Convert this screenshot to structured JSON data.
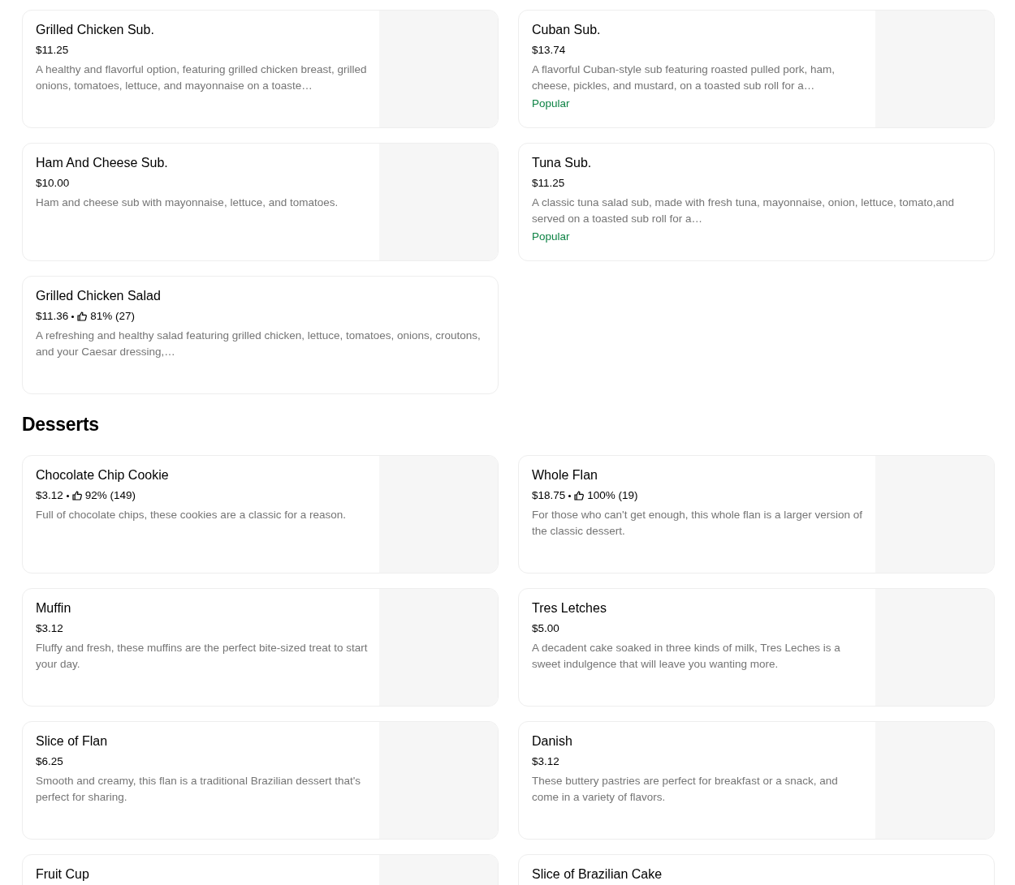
{
  "sections": [
    {
      "items": [
        {
          "name": "Grilled Chicken Sub.",
          "price": "$11.25",
          "description": "A healthy and flavorful option, featuring grilled chicken breast, grilled onions, tomatoes, lettuce, and mayonnaise on a toaste…",
          "has_image": true
        },
        {
          "name": "Cuban Sub.",
          "price": "$13.74",
          "description": "A flavorful Cuban-style sub featuring roasted pulled pork, ham, cheese, pickles, and mustard, on a toasted sub roll for a…",
          "badge": "Popular",
          "has_image": true
        },
        {
          "name": "Ham And Cheese Sub.",
          "price": "$10.00",
          "description": "Ham and cheese sub with mayonnaise, lettuce, and tomatoes.",
          "has_image": true
        },
        {
          "name": "Tuna Sub.",
          "price": "$11.25",
          "description": "A classic tuna salad sub, made with fresh tuna, mayonnaise, onion, lettuce, tomato,and served on a toasted sub roll for a…",
          "badge": "Popular",
          "has_image": false
        },
        {
          "name": "Grilled Chicken Salad",
          "price": "$11.36",
          "rating": "81% (27)",
          "description": "A refreshing and healthy salad featuring grilled chicken, lettuce, tomatoes, onions, croutons, and your Caesar dressing,…",
          "has_image": false
        }
      ]
    },
    {
      "title": "Desserts",
      "items": [
        {
          "name": "Chocolate Chip Cookie",
          "price": "$3.12",
          "rating": "92% (149)",
          "description": "Full of chocolate chips, these cookies are a classic for a reason.",
          "has_image": true
        },
        {
          "name": "Whole Flan",
          "price": "$18.75",
          "rating": "100% (19)",
          "description": "For those who can't get enough, this whole flan is a larger version of the classic dessert.",
          "has_image": true
        },
        {
          "name": "Muffin",
          "price": "$3.12",
          "description": "Fluffy and fresh, these muffins are the perfect bite-sized treat to start your day.",
          "has_image": true
        },
        {
          "name": "Tres Letches",
          "price": "$5.00",
          "description": "A decadent cake soaked in three kinds of milk, Tres Leches is a sweet indulgence that will leave you wanting more.",
          "has_image": true
        },
        {
          "name": "Slice of Flan",
          "price": "$6.25",
          "description": "Smooth and creamy, this flan is a traditional Brazilian dessert that's perfect for sharing.",
          "has_image": true
        },
        {
          "name": "Danish",
          "price": "$3.12",
          "description": "These buttery pastries are perfect for breakfast or a snack, and come in a variety of flavors.",
          "has_image": true
        },
        {
          "name": "Fruit Cup",
          "has_image": true
        },
        {
          "name": "Slice of Brazilian Cake",
          "has_image": false
        }
      ]
    }
  ]
}
